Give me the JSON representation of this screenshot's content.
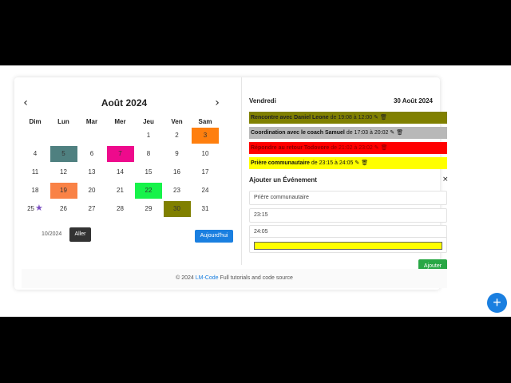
{
  "calendar": {
    "month_title": "Août 2024",
    "prev_icon": "chevron-left-icon",
    "next_icon": "chevron-right-icon",
    "prev_symbol": "‹",
    "next_symbol": "›",
    "weekdays": [
      "Dim",
      "Lun",
      "Mar",
      "Mer",
      "Jeu",
      "Ven",
      "Sam"
    ],
    "weeks": [
      [
        null,
        null,
        null,
        null,
        {
          "d": "1"
        },
        {
          "d": "2"
        },
        {
          "d": "3",
          "color": "#ff7f0e"
        }
      ],
      [
        {
          "d": "4"
        },
        {
          "d": "5",
          "color": "#4f8080"
        },
        {
          "d": "6"
        },
        {
          "d": "7",
          "color": "#ee0a8c"
        },
        {
          "d": "8"
        },
        {
          "d": "9"
        },
        {
          "d": "10"
        }
      ],
      [
        {
          "d": "11"
        },
        {
          "d": "12"
        },
        {
          "d": "13"
        },
        {
          "d": "14"
        },
        {
          "d": "15"
        },
        {
          "d": "16"
        },
        {
          "d": "17"
        }
      ],
      [
        {
          "d": "18"
        },
        {
          "d": "19",
          "color": "#f98246"
        },
        {
          "d": "20"
        },
        {
          "d": "21"
        },
        {
          "d": "22",
          "color": "#16f34a"
        },
        {
          "d": "23"
        },
        {
          "d": "24"
        }
      ],
      [
        {
          "d": "25",
          "star": "★"
        },
        {
          "d": "26"
        },
        {
          "d": "27"
        },
        {
          "d": "28"
        },
        {
          "d": "29"
        },
        {
          "d": "30",
          "color": "#808000"
        },
        {
          "d": "31"
        }
      ]
    ],
    "year_input_value": "10/2024",
    "go_label": "Aller",
    "today_label": "Aujourd'hui"
  },
  "day_panel": {
    "day_name": "Vendredi",
    "date": "30 Août 2024",
    "events": [
      {
        "title": "Rencontre avec Daniel Leone",
        "time": " de 19:08 à 12:00",
        "bg": "#808000",
        "fg": "#222222"
      },
      {
        "title": "Coordination avec le coach Samuel",
        "time": " de 17:03 à 20:02",
        "bg": "#b8b8b8",
        "fg": "#111111"
      },
      {
        "title": "Répondre au retour Todovore",
        "time": " de 21:02 à 23:02",
        "bg": "#ff0000",
        "fg": "#8a0000"
      },
      {
        "title": "Prière communautaire",
        "time": " de 23:15 à 24:05",
        "bg": "#ffff00",
        "fg": "#111111"
      }
    ],
    "edit_icon": "✎",
    "delete_icon": "🗑"
  },
  "form": {
    "title": "Ajouter un Événement",
    "close_symbol": "×",
    "name_value": "Prière communautaire",
    "start_value": "23:15",
    "end_value": "24:05",
    "color_value": "#ffff00",
    "add_label": "Ajouter"
  },
  "footer": {
    "prefix": "© 2024 ",
    "brand": "LM-Code",
    "suffix": " Full tutorials and code source"
  },
  "fab_symbol": "+",
  "colors": {
    "primary": "#1a7fe0",
    "success": "#28a745",
    "dark": "#333333"
  }
}
